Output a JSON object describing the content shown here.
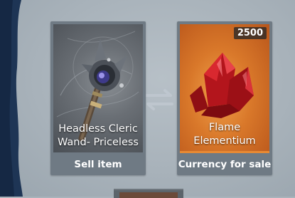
{
  "trade": {
    "sell_card": {
      "item_name_line1": "Headless Cleric",
      "item_name_line2": "Wand- Priceless",
      "caption": "Sell item",
      "icon": "cleric-wand-icon"
    },
    "buy_card": {
      "quantity": "2500",
      "item_name_line1": "Flame",
      "item_name_line2": "Elementium",
      "caption": "Currency for sale",
      "icon": "red-crystal-icon",
      "accent_color": "#e88a34"
    },
    "swap_icon": "swap-arrows-icon"
  }
}
